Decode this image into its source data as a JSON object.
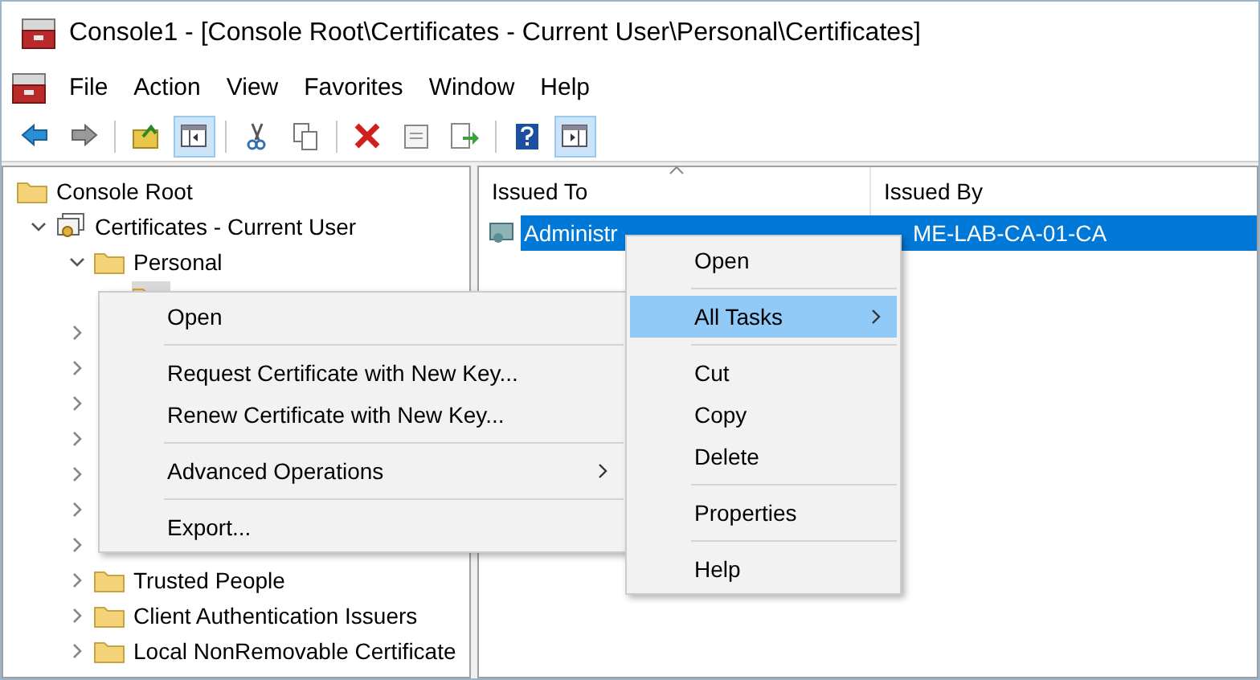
{
  "window": {
    "title": "Console1 - [Console Root\\Certificates - Current User\\Personal\\Certificates]"
  },
  "menu_bar": [
    "File",
    "Action",
    "View",
    "Favorites",
    "Window",
    "Help"
  ],
  "toolbar": [
    {
      "kind": "back",
      "pressed": false
    },
    {
      "kind": "forward",
      "pressed": false
    },
    {
      "kind": "sep"
    },
    {
      "kind": "up",
      "pressed": false
    },
    {
      "kind": "tree",
      "pressed": true
    },
    {
      "kind": "sep"
    },
    {
      "kind": "cut",
      "pressed": false
    },
    {
      "kind": "copy",
      "pressed": false
    },
    {
      "kind": "sep"
    },
    {
      "kind": "delete",
      "pressed": false
    },
    {
      "kind": "properties",
      "pressed": false
    },
    {
      "kind": "export",
      "pressed": false
    },
    {
      "kind": "sep"
    },
    {
      "kind": "help",
      "pressed": false
    },
    {
      "kind": "action",
      "pressed": true
    }
  ],
  "tree": [
    {
      "label": "Console Root",
      "kind": "folder",
      "selected": false,
      "children": [
        {
          "label": "Certificates - Current User",
          "kind": "store",
          "expanded": true,
          "selected": false,
          "children": [
            {
              "label": "Personal",
              "kind": "folder",
              "expanded": true,
              "selected": false,
              "children": [
                {
                  "kind": "folder",
                  "selected": true
                }
              ]
            },
            {
              "expanded": false
            },
            {
              "expanded": false
            },
            {
              "expanded": false
            },
            {
              "expanded": false
            },
            {
              "expanded": false
            },
            {
              "expanded": false
            },
            {
              "expanded": false
            },
            {
              "label": "Trusted People",
              "kind": "folder",
              "expanded": false,
              "selected": false
            },
            {
              "label": "Client Authentication Issuers",
              "kind": "folder",
              "expanded": false,
              "selected": false
            },
            {
              "label": "Local NonRemovable Certificate",
              "kind": "folder",
              "expanded": false,
              "selected": false
            }
          ]
        }
      ]
    }
  ],
  "list": {
    "columns": [
      {
        "label": "Issued To",
        "sorted": true
      },
      {
        "label": "Issued By",
        "sorted": false
      }
    ],
    "rows": [
      {
        "issued_to": "Administr",
        "issued_by": "ME-LAB-CA-01-CA",
        "selected": true
      }
    ]
  },
  "context_menus": [
    {
      "items": [
        {
          "kind": "item",
          "label": "Open",
          "submenu": false,
          "selected": false
        },
        {
          "kind": "sep"
        },
        {
          "kind": "item",
          "label": "Request Certificate with New Key...",
          "submenu": false,
          "selected": false
        },
        {
          "kind": "item",
          "label": "Renew Certificate with New Key...",
          "submenu": false,
          "selected": false
        },
        {
          "kind": "sep"
        },
        {
          "kind": "item",
          "label": "Advanced Operations",
          "submenu": true,
          "selected": false
        },
        {
          "kind": "sep"
        },
        {
          "kind": "item",
          "label": "Export...",
          "submenu": false,
          "selected": false
        }
      ]
    },
    {
      "items": [
        {
          "kind": "item",
          "label": "Open",
          "submenu": false,
          "selected": false
        },
        {
          "kind": "sep"
        },
        {
          "kind": "item",
          "label": "All Tasks",
          "submenu": true,
          "selected": true
        },
        {
          "kind": "sep"
        },
        {
          "kind": "item",
          "label": "Cut",
          "submenu": false,
          "selected": false
        },
        {
          "kind": "item",
          "label": "Copy",
          "submenu": false,
          "selected": false
        },
        {
          "kind": "item",
          "label": "Delete",
          "submenu": false,
          "selected": false
        },
        {
          "kind": "sep"
        },
        {
          "kind": "item",
          "label": "Properties",
          "submenu": false,
          "selected": false
        },
        {
          "kind": "sep"
        },
        {
          "kind": "item",
          "label": "Help",
          "submenu": false,
          "selected": false
        }
      ]
    }
  ]
}
